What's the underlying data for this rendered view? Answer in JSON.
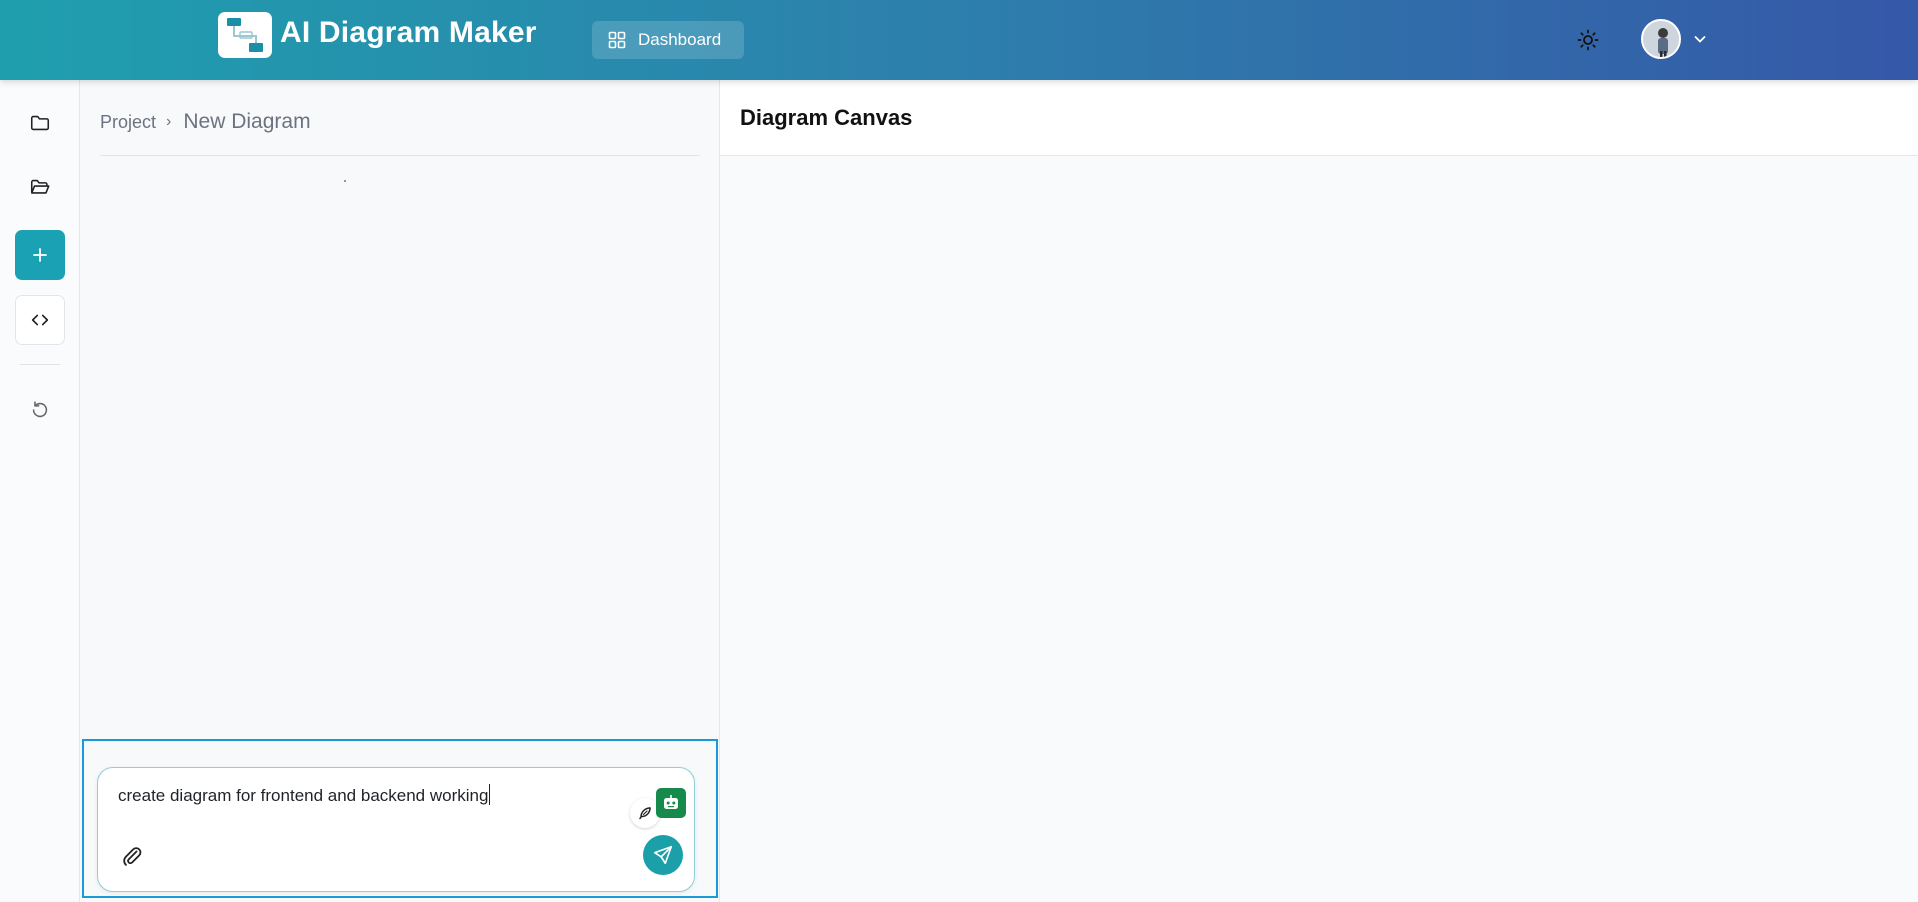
{
  "header": {
    "app_title": "AI Diagram Maker",
    "dashboard_label": "Dashboard",
    "logo_icon": "diagram-logo-icon",
    "theme_icon": "sun-icon",
    "avatar_icon": "user-avatar",
    "menu_icon": "chevron-down-icon"
  },
  "rail": {
    "items": [
      {
        "name": "folder",
        "icon": "folder-icon"
      },
      {
        "name": "folder-open",
        "icon": "folder-open-icon"
      },
      {
        "name": "new-diagram",
        "icon": "plus-icon",
        "active": true
      },
      {
        "name": "code",
        "icon": "code-icon"
      },
      {
        "name": "history",
        "icon": "undo-icon"
      }
    ]
  },
  "chat": {
    "breadcrumb": {
      "project": "Project",
      "separator": "›",
      "current": "New Diagram"
    },
    "composer": {
      "prompt_value": "create diagram for frontend and backend working",
      "attach_icon": "paperclip-icon",
      "send_icon": "send-icon",
      "feather_icon": "feather-icon",
      "bot_icon": "robot-icon"
    }
  },
  "canvas": {
    "title": "Diagram Canvas"
  },
  "colors": {
    "header_gradient_start": "#1f9fae",
    "header_gradient_end": "#3558a8",
    "accent": "#1aa2b4",
    "focus_border": "#1a9ad6",
    "bot_green": "#168a4a"
  }
}
